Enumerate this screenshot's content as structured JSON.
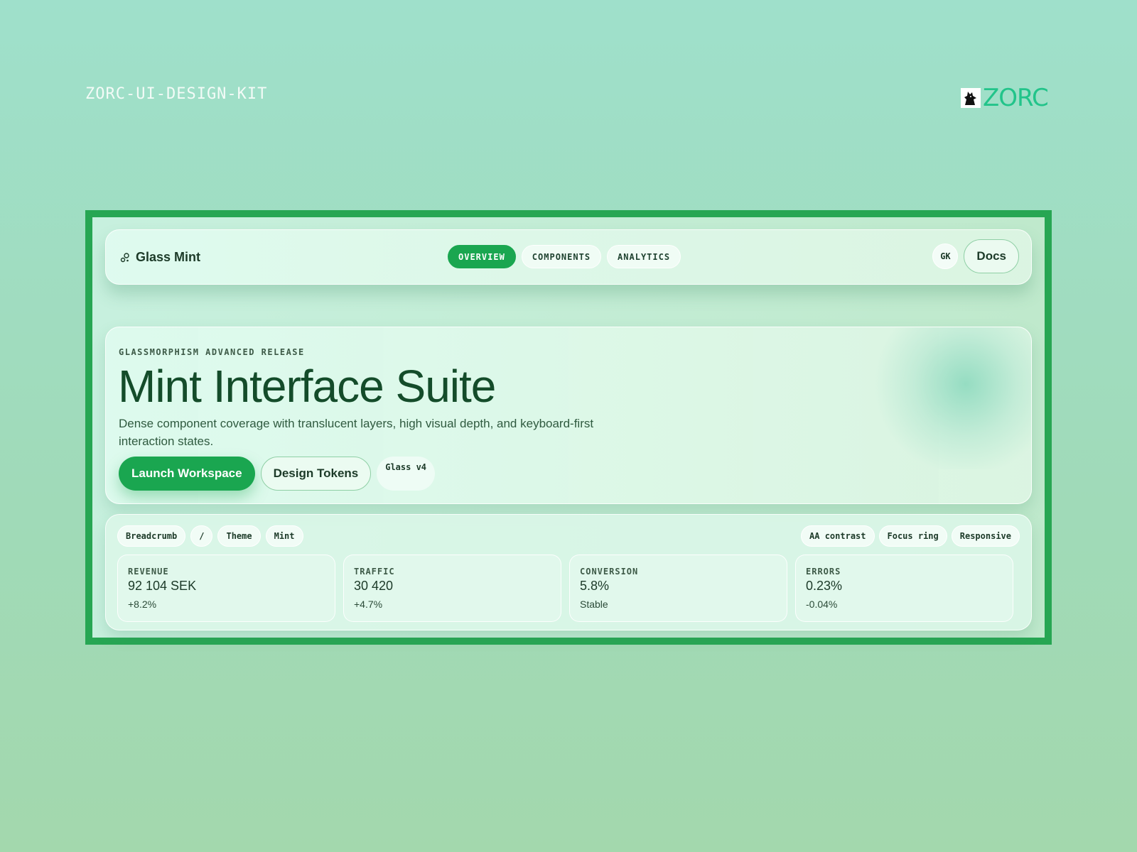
{
  "kit_label": "ZORC-UI-DESIGN-KIT",
  "brand": {
    "logo_icon": "wolf-icon",
    "wordmark": "ZORC",
    "accent": "#22c48a"
  },
  "navbar": {
    "brand_icon": "bubbles-icon",
    "brand_name": "Glass Mint",
    "tabs": [
      {
        "label": "OVERVIEW",
        "active": true
      },
      {
        "label": "COMPONENTS",
        "active": false
      },
      {
        "label": "ANALYTICS",
        "active": false
      }
    ],
    "avatar_initials": "GK",
    "docs_label": "Docs"
  },
  "hero": {
    "eyebrow": "GLASSMORPHISM ADVANCED RELEASE",
    "title": "Mint Interface Suite",
    "description": "Dense component coverage with translucent layers, high visual depth, and keyboard-first interaction states.",
    "primary_label": "Launch Workspace",
    "secondary_label": "Design Tokens",
    "version_chip": "Glass v4"
  },
  "panel": {
    "breadcrumb": [
      "Breadcrumb",
      "/",
      "Theme",
      "Mint"
    ],
    "badges": [
      "AA contrast",
      "Focus ring",
      "Responsive"
    ],
    "stats": [
      {
        "label": "REVENUE",
        "value": "92 104 SEK",
        "delta": "+8.2%"
      },
      {
        "label": "TRAFFIC",
        "value": "30 420",
        "delta": "+4.7%"
      },
      {
        "label": "CONVERSION",
        "value": "5.8%",
        "delta": "Stable"
      },
      {
        "label": "ERRORS",
        "value": "0.23%",
        "delta": "-0.04%"
      }
    ]
  },
  "colors": {
    "primary": "#1aa650",
    "frame": "#27a653",
    "text_dark": "#144c2a"
  }
}
